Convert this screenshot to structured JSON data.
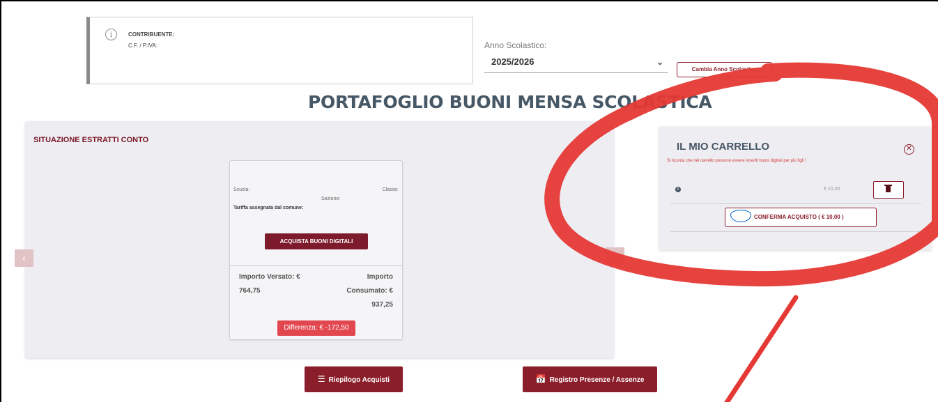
{
  "contribuente": {
    "label": "CONTRIBUENTE:",
    "cf_label": "C.F. / P.IVA:"
  },
  "anno": {
    "label": "Anno Scolastico:",
    "selected": "2025/2026",
    "change_button": "Cambia Anno Scolastico"
  },
  "page_title": "PORTAFOGLIO BUONI MENSA SCOLASTICA",
  "situazione": {
    "title": "SITUAZIONE ESTRATTI CONTO",
    "card": {
      "scuola": "Scuola:",
      "classe": "Classe:",
      "sezione": "Sezione:",
      "tariffa": "Tariffa assegnata dal comune:",
      "acquista_button": "ACQUISTA BUONI DIGITALI",
      "versato_label": "Importo Versato: €",
      "versato_value": "764,75",
      "consumato_label_1": "Importo",
      "consumato_label_2": "Consumato: €",
      "consumato_value": "937,25",
      "differenza": "Differenza: € -172,50"
    }
  },
  "buttons": {
    "riepilogo": "Riepilogo Acquisti",
    "registro": "Registro Presenze / Assenze"
  },
  "cart": {
    "title": "IL MIO CARRELLO",
    "note": "Si ricorda che nel carrello possono essere inseriti buoni digitali per più figli !",
    "item_price": "€ 10,00",
    "confirm_button": "CONFERMA ACQUISTO ( € 10,00 )",
    "pagopa_logo": "pagoPA"
  },
  "colors": {
    "accent": "#8b1e2b",
    "title": "#465766",
    "panel": "#eeedf2",
    "annotation": "#e53935"
  }
}
